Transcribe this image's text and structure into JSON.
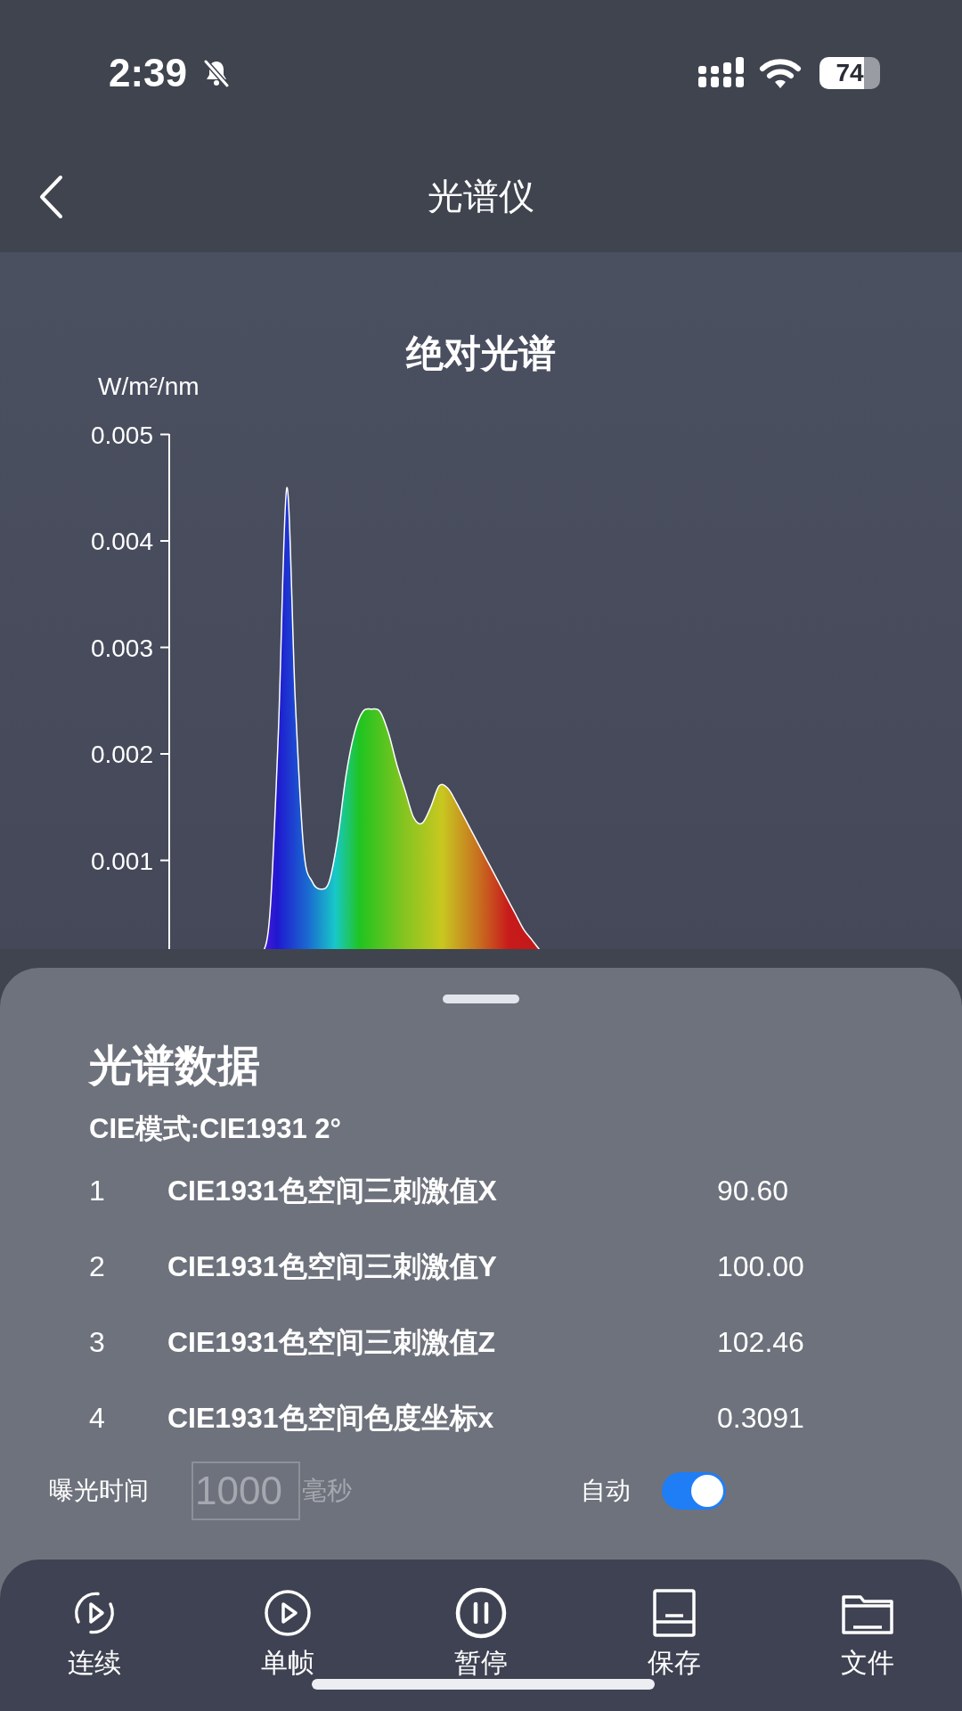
{
  "status_bar": {
    "time": "2:39",
    "battery": "74"
  },
  "nav": {
    "title": "光谱仪"
  },
  "chart": {
    "title": "绝对光谱",
    "unit": "W/m²/nm",
    "ticks": [
      "0.005",
      "0.004",
      "0.003",
      "0.002",
      "0.001"
    ]
  },
  "sheet": {
    "title": "光谱数据",
    "mode": "CIE模式:CIE1931 2°",
    "rows": [
      {
        "index": "1",
        "name": "CIE1931色空间三刺激值X",
        "value": "90.60"
      },
      {
        "index": "2",
        "name": "CIE1931色空间三刺激值Y",
        "value": "100.00"
      },
      {
        "index": "3",
        "name": "CIE1931色空间三刺激值Z",
        "value": "102.46"
      },
      {
        "index": "4",
        "name": "CIE1931色空间色度坐标x",
        "value": "0.3091"
      }
    ],
    "exposure": {
      "label": "曝光时间",
      "placeholder": "1000",
      "unit": "毫秒"
    },
    "auto": {
      "label": "自动",
      "on": true
    }
  },
  "toolbar": [
    {
      "kind": "continuous",
      "label": "连续"
    },
    {
      "kind": "single",
      "label": "单帧"
    },
    {
      "kind": "pause",
      "label": "暂停"
    },
    {
      "kind": "save",
      "label": "保存"
    },
    {
      "kind": "file",
      "label": "文件"
    }
  ]
}
